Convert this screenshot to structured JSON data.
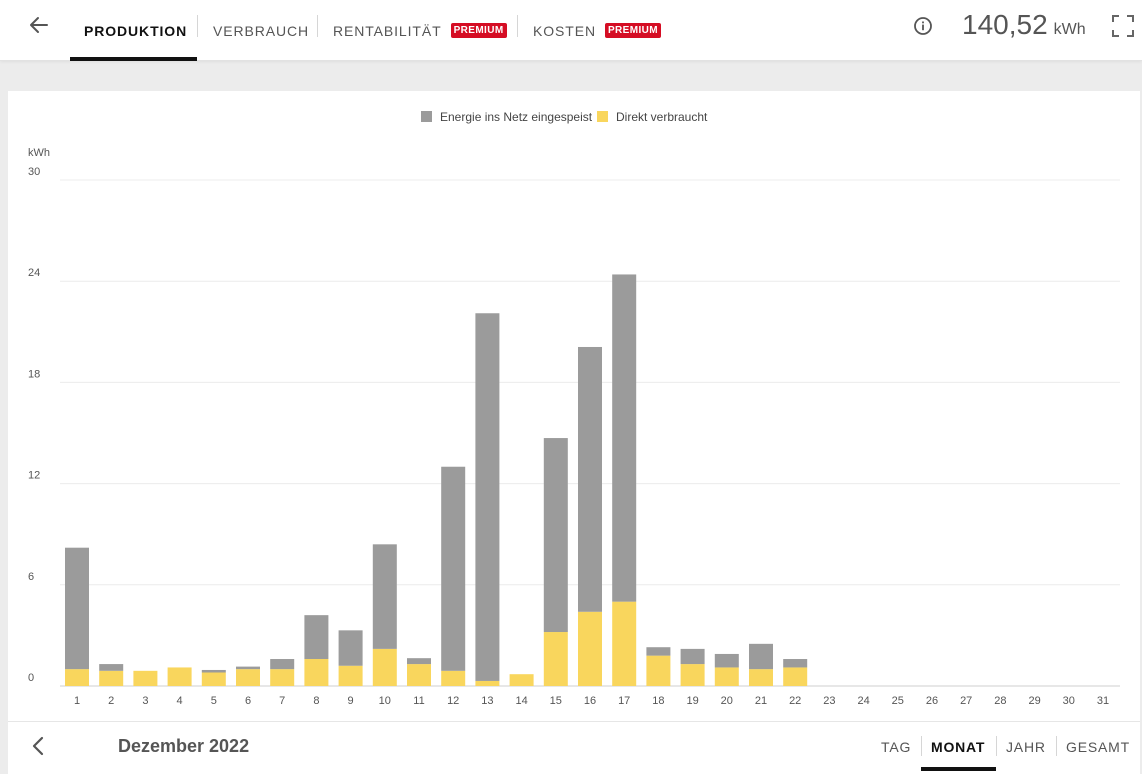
{
  "header": {
    "back_icon": "arrow-left-icon",
    "tabs": [
      {
        "label": "PRODUKTION",
        "badge": "",
        "active": true
      },
      {
        "label": "VERBRAUCH",
        "badge": "",
        "active": false
      },
      {
        "label": "RENTABILITÄT",
        "badge": "PREMIUM",
        "active": false
      },
      {
        "label": "KOSTEN",
        "badge": "PREMIUM",
        "active": false
      }
    ],
    "info_icon": "info-icon",
    "total_value": "140,52",
    "total_unit": "kWh",
    "fullscreen_icon": "fullscreen-icon",
    "badge_color": "#d50d24"
  },
  "footer": {
    "prev_icon": "chevron-left-icon",
    "period_label": "Dezember 2022",
    "period_tabs": [
      {
        "label": "TAG",
        "active": false
      },
      {
        "label": "MONAT",
        "active": true
      },
      {
        "label": "JAHR",
        "active": false
      },
      {
        "label": "GESAMT",
        "active": false
      }
    ]
  },
  "chart_data": {
    "type": "bar",
    "stacked": true,
    "ylabel": "kWh",
    "ylim": [
      0,
      30
    ],
    "yticks": [
      0,
      6,
      12,
      18,
      24,
      30
    ],
    "grid": true,
    "legend_position": "top-center",
    "categories": [
      "1",
      "2",
      "3",
      "4",
      "5",
      "6",
      "7",
      "8",
      "9",
      "10",
      "11",
      "12",
      "13",
      "14",
      "15",
      "16",
      "17",
      "18",
      "19",
      "20",
      "21",
      "22",
      "23",
      "24",
      "25",
      "26",
      "27",
      "28",
      "29",
      "30",
      "31"
    ],
    "series": [
      {
        "name": "Direkt verbraucht",
        "color": "#f9d65d",
        "values": [
          1.0,
          0.9,
          0.9,
          1.1,
          0.8,
          1.0,
          1.0,
          1.6,
          1.2,
          2.2,
          1.3,
          0.9,
          0.3,
          0.7,
          3.2,
          4.4,
          5.0,
          1.8,
          1.3,
          1.1,
          1.0,
          1.1,
          0,
          0,
          0,
          0,
          0,
          0,
          0,
          0,
          0
        ]
      },
      {
        "name": "Energie ins Netz eingespeist",
        "color": "#9b9b9b",
        "values": [
          7.2,
          0.4,
          0.0,
          0.0,
          0.15,
          0.15,
          0.6,
          2.6,
          2.1,
          6.2,
          0.35,
          12.1,
          21.8,
          0.0,
          11.5,
          15.7,
          19.4,
          0.5,
          0.9,
          0.8,
          1.5,
          0.5,
          0,
          0,
          0,
          0,
          0,
          0,
          0,
          0,
          0
        ]
      }
    ],
    "legend_order": [
      "Energie ins Netz eingespeist",
      "Direkt verbraucht"
    ]
  }
}
